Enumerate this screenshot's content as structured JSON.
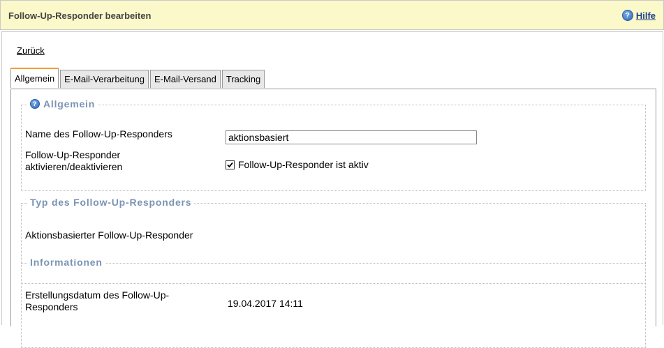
{
  "header": {
    "title": "Follow-Up-Responder bearbeiten",
    "help_label": "Hilfe"
  },
  "nav": {
    "back_label": "Zurück"
  },
  "tabs": [
    {
      "label": "Allgemein",
      "active": true
    },
    {
      "label": "E-Mail-Verarbeitung",
      "active": false
    },
    {
      "label": "E-Mail-Versand",
      "active": false
    },
    {
      "label": "Tracking",
      "active": false
    }
  ],
  "general": {
    "legend": "Allgemein",
    "name_label": "Name des Follow-Up-Responders",
    "name_value": "aktionsbasiert",
    "active_label": "Follow-Up-Responder aktivieren/deaktivieren",
    "active_checkbox_label": "Follow-Up-Responder ist aktiv",
    "active_checked": true
  },
  "type": {
    "legend": "Typ des Follow-Up-Responders",
    "value": "Aktionsbasierter Follow-Up-Responder"
  },
  "info": {
    "legend": "Informationen",
    "created_label": "Erstellungsdatum des Follow-Up-Responders",
    "created_value": "19.04.2017 14:11"
  },
  "colors": {
    "header_bg": "#fbf8c9",
    "legend_text": "#7a93b5",
    "active_tab_accent": "#f0a030"
  },
  "icons": {
    "help": "help-icon",
    "checkbox": "check-icon"
  }
}
